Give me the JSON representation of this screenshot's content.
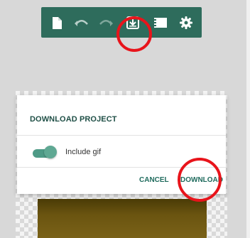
{
  "toolbar": {
    "icons": [
      "file-icon",
      "undo-icon",
      "redo-icon",
      "download-icon",
      "film-icon",
      "gear-icon"
    ]
  },
  "dialog": {
    "title": "DOWNLOAD PROJECT",
    "toggle": {
      "label": "Include gif",
      "checked": true
    },
    "cancel_label": "CANCEL",
    "download_label": "DOWNLOAD"
  },
  "colors": {
    "toolbar": "#2e6c5c",
    "accent": "#1f6b5d",
    "annotation": "#e8141b"
  }
}
